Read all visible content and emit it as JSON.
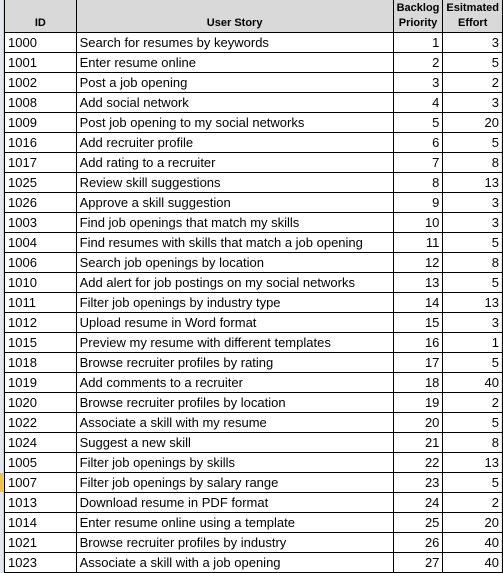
{
  "sheet": {
    "headers": {
      "id": "ID",
      "story": "User Story",
      "priority_line1": "Backlog",
      "priority_line2": "Priority",
      "effort_line1": "Esitmated",
      "effort_line2": "Effort"
    },
    "selected_row_id": "1007",
    "rows": [
      {
        "id": "1000",
        "story": "Search for resumes by keywords",
        "priority": "1",
        "effort": "3"
      },
      {
        "id": "1001",
        "story": "Enter resume online",
        "priority": "2",
        "effort": "5"
      },
      {
        "id": "1002",
        "story": "Post a job opening",
        "priority": "3",
        "effort": "2"
      },
      {
        "id": "1008",
        "story": "Add social network",
        "priority": "4",
        "effort": "3"
      },
      {
        "id": "1009",
        "story": "Post job opening to my social networks",
        "priority": "5",
        "effort": "20"
      },
      {
        "id": "1016",
        "story": "Add recruiter profile",
        "priority": "6",
        "effort": "5"
      },
      {
        "id": "1017",
        "story": "Add rating to a recruiter",
        "priority": "7",
        "effort": "8"
      },
      {
        "id": "1025",
        "story": "Review skill suggestions",
        "priority": "8",
        "effort": "13"
      },
      {
        "id": "1026",
        "story": "Approve a skill suggestion",
        "priority": "9",
        "effort": "3"
      },
      {
        "id": "1003",
        "story": "Find job openings that match my skills",
        "priority": "10",
        "effort": "3"
      },
      {
        "id": "1004",
        "story": "Find resumes with skills that match a job opening",
        "priority": "11",
        "effort": "5"
      },
      {
        "id": "1006",
        "story": "Search job openings by location",
        "priority": "12",
        "effort": "8"
      },
      {
        "id": "1010",
        "story": "Add alert for job postings on my social networks",
        "priority": "13",
        "effort": "5"
      },
      {
        "id": "1011",
        "story": "Filter job openings by industry type",
        "priority": "14",
        "effort": "13"
      },
      {
        "id": "1012",
        "story": "Upload resume in Word format",
        "priority": "15",
        "effort": "3"
      },
      {
        "id": "1015",
        "story": "Preview my resume with different templates",
        "priority": "16",
        "effort": "1"
      },
      {
        "id": "1018",
        "story": "Browse recruiter profiles by rating",
        "priority": "17",
        "effort": "5"
      },
      {
        "id": "1019",
        "story": "Add comments to a recruiter",
        "priority": "18",
        "effort": "40"
      },
      {
        "id": "1020",
        "story": "Browse recruiter profiles by location",
        "priority": "19",
        "effort": "2"
      },
      {
        "id": "1022",
        "story": "Associate a skill with my resume",
        "priority": "20",
        "effort": "5"
      },
      {
        "id": "1024",
        "story": "Suggest a new skill",
        "priority": "21",
        "effort": "8"
      },
      {
        "id": "1005",
        "story": "Filter job openings by skills",
        "priority": "22",
        "effort": "13"
      },
      {
        "id": "1007",
        "story": "Filter job openings by salary range",
        "priority": "23",
        "effort": "5"
      },
      {
        "id": "1013",
        "story": "Download resume in PDF format",
        "priority": "24",
        "effort": "2"
      },
      {
        "id": "1014",
        "story": "Enter resume online using a template",
        "priority": "25",
        "effort": "20"
      },
      {
        "id": "1021",
        "story": "Browse recruiter profiles by industry",
        "priority": "26",
        "effort": "40"
      },
      {
        "id": "1023",
        "story": "Associate a skill with a job opening",
        "priority": "27",
        "effort": "40"
      }
    ]
  }
}
